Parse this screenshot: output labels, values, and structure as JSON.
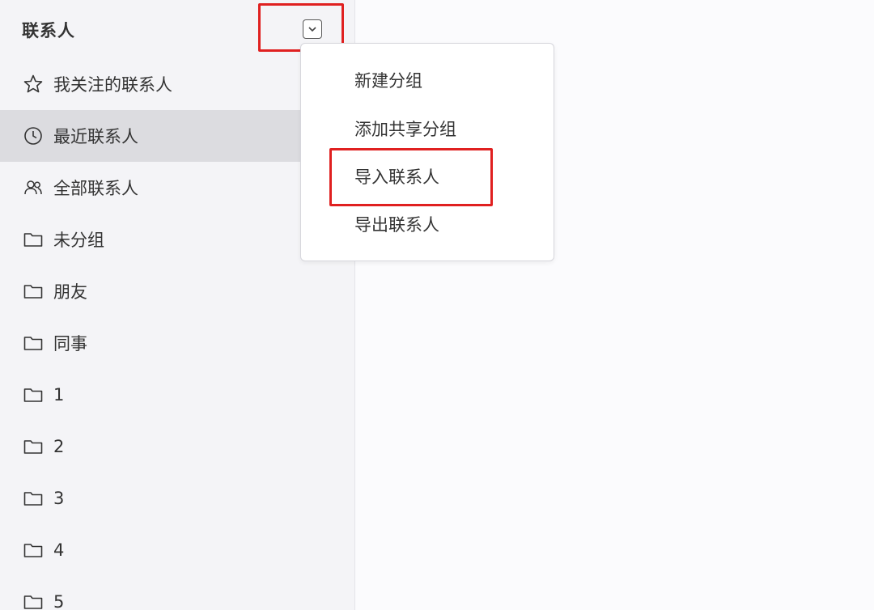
{
  "sidebar": {
    "title": "联系人",
    "items": [
      {
        "label": "我关注的联系人",
        "icon": "star-icon"
      },
      {
        "label": "最近联系人",
        "icon": "clock-icon",
        "active": true
      },
      {
        "label": "全部联系人",
        "icon": "people-icon"
      },
      {
        "label": "未分组",
        "icon": "folder-icon"
      },
      {
        "label": "朋友",
        "icon": "folder-icon"
      },
      {
        "label": "同事",
        "icon": "folder-icon"
      },
      {
        "label": "1",
        "icon": "folder-icon"
      },
      {
        "label": "2",
        "icon": "folder-icon"
      },
      {
        "label": "3",
        "icon": "folder-icon"
      },
      {
        "label": "4",
        "icon": "folder-icon"
      },
      {
        "label": "5",
        "icon": "folder-icon"
      }
    ]
  },
  "menu": {
    "items": [
      {
        "label": "新建分组"
      },
      {
        "label": "添加共享分组"
      },
      {
        "label": "导入联系人"
      },
      {
        "label": "导出联系人"
      }
    ]
  },
  "colors": {
    "highlight": "#e02020",
    "sidebar_bg": "#f4f4f7",
    "active_bg": "#dcdce0"
  }
}
